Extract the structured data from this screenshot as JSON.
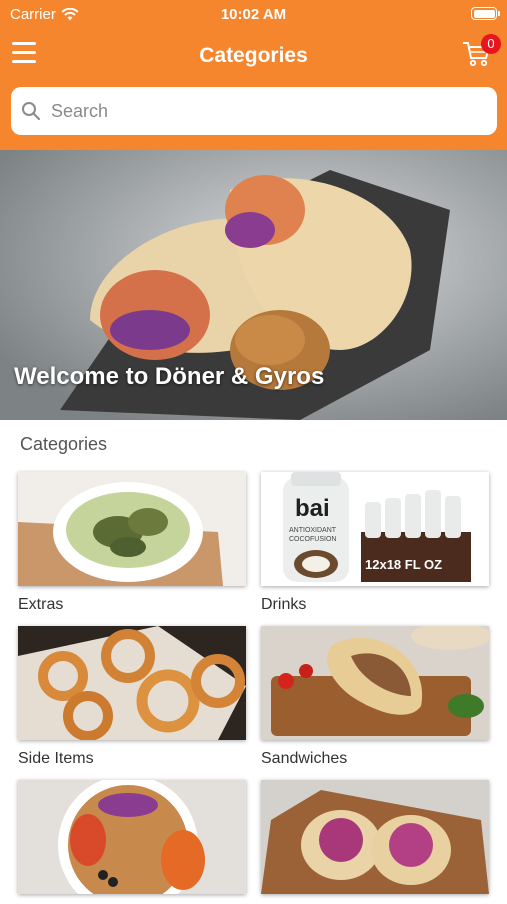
{
  "status": {
    "carrier": "Carrier",
    "time": "10:02 AM"
  },
  "nav": {
    "title": "Categories",
    "cart_count": "0"
  },
  "search": {
    "placeholder": "Search"
  },
  "hero": {
    "caption": "Welcome to Döner & Gyros"
  },
  "categories": {
    "heading": "Categories",
    "items": [
      {
        "label": "Extras"
      },
      {
        "label": "Drinks"
      },
      {
        "label": "Side Items"
      },
      {
        "label": "Sandwiches"
      },
      {
        "label": ""
      },
      {
        "label": ""
      }
    ]
  },
  "drinks_image_text": {
    "brand": "bai",
    "line1": "ANTIOXIDANT",
    "line2": "COCOFUSION",
    "pack": "12x18 FL OZ"
  },
  "colors": {
    "accent": "#f5862d",
    "badge": "#e8141e"
  }
}
